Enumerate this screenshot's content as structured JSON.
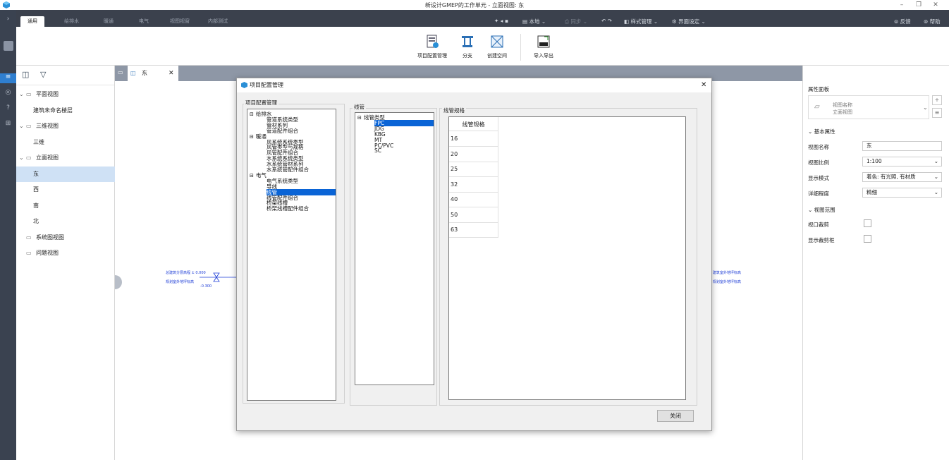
{
  "window": {
    "title": "新设计GMEP的工作单元 - 立面视图: 东"
  },
  "ribbon_tabs": [
    "通用",
    "给排水",
    "暖通",
    "电气",
    "视图视窗",
    "内部测试"
  ],
  "quick_access": {
    "local_label": "本地",
    "sync_label": "同步",
    "style_label": "样式管理",
    "ui_label": "界面设定",
    "feedback_label": "反馈",
    "help_label": "帮助"
  },
  "ribbon_buttons": {
    "project_config": "项目配置管理",
    "branch": "分支",
    "create_space": "创建空间",
    "import_export": "导入导出"
  },
  "tree": [
    {
      "label": "平面视图",
      "level": 0,
      "expanded": true
    },
    {
      "label": "建筑未命名楼层",
      "level": 1
    },
    {
      "label": "三维视图",
      "level": 0,
      "expanded": true
    },
    {
      "label": "三维",
      "level": 1
    },
    {
      "label": "立面视图",
      "level": 0,
      "expanded": true
    },
    {
      "label": "东",
      "level": 1,
      "selected": true
    },
    {
      "label": "西",
      "level": 1
    },
    {
      "label": "南",
      "level": 1
    },
    {
      "label": "北",
      "level": 1
    },
    {
      "label": "系统图视图",
      "level": 0
    },
    {
      "label": "问题视图",
      "level": 0
    }
  ],
  "view_tab": {
    "label": "东"
  },
  "canvas_text": {
    "left_top": "总建筑分层高程 ± 0.000",
    "left_bottom": "规划室外地坪标高",
    "left_value": "-0.300",
    "right_top": "0.000  建筑室外地坪标高",
    "right_bottom": "0.300  规划室外地坪标高"
  },
  "properties": {
    "panel_title": "属性面板",
    "type_name": "视图名称",
    "type_sub": "立面视图",
    "section_basic": "基本属性",
    "view_name_label": "视图名称",
    "view_name_value": "东",
    "scale_label": "视图比例",
    "scale_value": "1:100",
    "display_label": "显示模式",
    "display_value": "着色: 有光照, 有材质",
    "detail_label": "详细程度",
    "detail_value": "精细",
    "section_range": "视图范围",
    "crop_label": "视口裁剪",
    "show_crop_label": "显示裁剪框"
  },
  "dialog": {
    "title": "项目配置管理",
    "left_group": "项目配置管理",
    "left_tree": [
      {
        "label": "给排水",
        "indent": 0,
        "expander": "⊟"
      },
      {
        "label": "管道系统类型",
        "indent": 2
      },
      {
        "label": "管材系列",
        "indent": 2
      },
      {
        "label": "管道配件组合",
        "indent": 2
      },
      {
        "label": "暖通",
        "indent": 0,
        "expander": "⊟"
      },
      {
        "label": "风系统系统类型",
        "indent": 2
      },
      {
        "label": "风管类型与规格",
        "indent": 2
      },
      {
        "label": "风管配件组合",
        "indent": 2
      },
      {
        "label": "水系统系统类型",
        "indent": 2
      },
      {
        "label": "水系统管材系列",
        "indent": 2
      },
      {
        "label": "水系统管配件组合",
        "indent": 2
      },
      {
        "label": "电气",
        "indent": 0,
        "expander": "⊟"
      },
      {
        "label": "电气系统类型",
        "indent": 2
      },
      {
        "label": "导线",
        "indent": 2
      },
      {
        "label": "线管",
        "indent": 2,
        "selected": true
      },
      {
        "label": "线管配件组合",
        "indent": 2
      },
      {
        "label": "桥架线槽",
        "indent": 2
      },
      {
        "label": "桥架线槽配件组合",
        "indent": 2
      }
    ],
    "mid_group": "线管",
    "mid_tree": [
      {
        "label": "线管类型",
        "indent": 0,
        "expander": "⊟"
      },
      {
        "label": "FPC",
        "indent": 2,
        "selected": true
      },
      {
        "label": "JDG",
        "indent": 2
      },
      {
        "label": "KBG",
        "indent": 2
      },
      {
        "label": "MT",
        "indent": 2
      },
      {
        "label": "PC/PVC",
        "indent": 2
      },
      {
        "label": "SC",
        "indent": 2
      }
    ],
    "right_group": "线管规格",
    "grid_header": "线管规格",
    "grid_values": [
      "16",
      "20",
      "25",
      "32",
      "40",
      "50",
      "63"
    ],
    "close_button": "关闭"
  }
}
